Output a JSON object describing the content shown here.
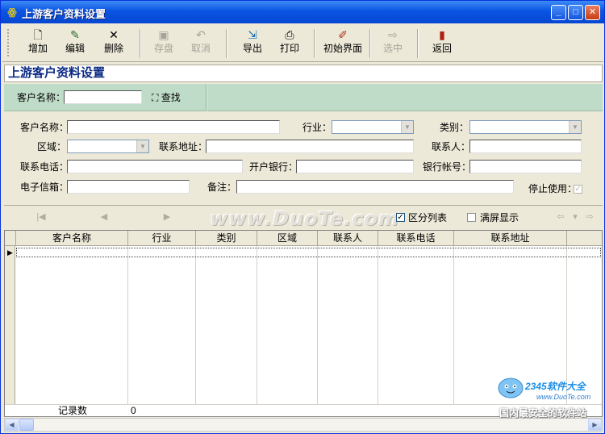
{
  "window": {
    "title": "上游客户资料设置",
    "app_icon": "cruise-logo-icon"
  },
  "toolbar": {
    "items": [
      {
        "label": "增加",
        "icon": "new-document-icon",
        "enabled": true
      },
      {
        "label": "编辑",
        "icon": "edit-icon",
        "enabled": true
      },
      {
        "label": "删除",
        "icon": "delete-icon",
        "enabled": true
      },
      {
        "label": "存盘",
        "icon": "save-icon",
        "enabled": false
      },
      {
        "label": "取消",
        "icon": "undo-icon",
        "enabled": false
      },
      {
        "label": "导出",
        "icon": "export-icon",
        "enabled": true
      },
      {
        "label": "打印",
        "icon": "printer-icon",
        "enabled": true
      },
      {
        "label": "初始界面",
        "icon": "paint-icon",
        "enabled": true
      },
      {
        "label": "选中",
        "icon": "select-icon",
        "enabled": false
      },
      {
        "label": "返回",
        "icon": "exit-door-icon",
        "enabled": true
      }
    ]
  },
  "heading": "上游客户资料设置",
  "search": {
    "label": "客户名称：",
    "value": "",
    "find_label": "查找"
  },
  "form": {
    "customer_name_label": "客户名称：",
    "industry_label": "行业：",
    "category_label": "类别：",
    "region_label": "区域：",
    "address_label": "联系地址：",
    "contact_label": "联系人：",
    "phone_label": "联系电话：",
    "bank_label": "开户银行：",
    "account_label": "银行帐号：",
    "email_label": "电子信箱：",
    "remark_label": "备注：",
    "disabled_label": "停止使用：",
    "disabled_checked": true
  },
  "nav": {
    "watermark": "www.DuoTe.com",
    "zone_list_label": "区分列表",
    "zone_list_checked": true,
    "fullscreen_label": "满屏显示",
    "fullscreen_checked": false
  },
  "grid": {
    "columns": [
      "客户名称",
      "行业",
      "类别",
      "区域",
      "联系人",
      "联系电话",
      "联系地址"
    ],
    "footer_label": "记录数",
    "footer_count": "0"
  },
  "corner_logo": {
    "brand": "2345软件大全",
    "site": "www.DuoTe.com",
    "slogan": "国内最安全的软件站"
  }
}
